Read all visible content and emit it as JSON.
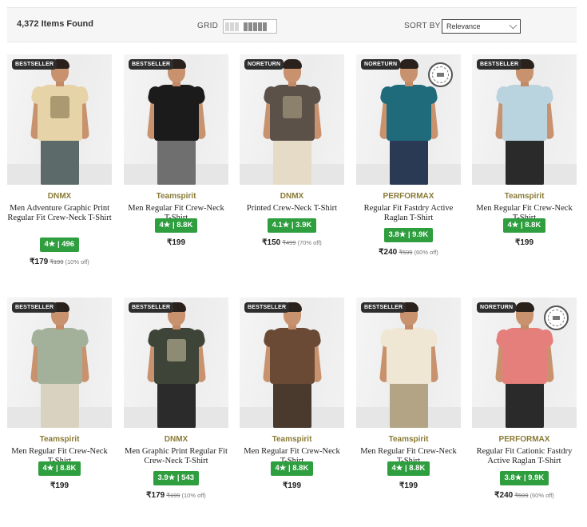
{
  "toolbar": {
    "items_found": "4,372 Items Found",
    "grid_label": "GRID",
    "sort_label": "SORT BY",
    "sort_value": "Relevance"
  },
  "colors": {
    "rating_green": "#2e9e3f",
    "brand_olive": "#8a7a36",
    "tag_dark": "#2e2e2e"
  },
  "products": [
    {
      "tag": "BESTSELLER",
      "brand": "DNMX",
      "name": "Men Adventure Graphic Print Regular Fit Crew-Neck T-Shirt",
      "rating": "4★ | 496",
      "price": "₹179",
      "mrp": "₹199",
      "off": "(10% off)",
      "seal": false,
      "shirt": "#e7d3a8",
      "pants": "#5c6b6a",
      "print": "#7a6a44"
    },
    {
      "tag": "BESTSELLER",
      "brand": "Teamspirit",
      "name": "Men Regular Fit Crew-Neck T-Shirt",
      "rating": "4★ | 8.8K",
      "price": "₹199",
      "mrp": "",
      "off": "",
      "seal": false,
      "shirt": "#1b1b1b",
      "pants": "#6f6f6f",
      "print": ""
    },
    {
      "tag": "NORETURN",
      "brand": "DNMX",
      "name": "Printed Crew-Neck T-Shirt",
      "rating": "4.1★ | 3.9K",
      "price": "₹150",
      "mrp": "₹499",
      "off": "(70% off)",
      "seal": false,
      "shirt": "#5b5148",
      "pants": "#e6dbc6",
      "print": "#b5a98c"
    },
    {
      "tag": "NORETURN",
      "brand": "PERFORMAX",
      "name": "Regular Fit Fastdry Active Raglan T-Shirt",
      "rating": "3.8★ | 9.9K",
      "price": "₹240",
      "mrp": "₹599",
      "off": "(60% off)",
      "seal": true,
      "shirt": "#1f6a7b",
      "pants": "#2a3a55",
      "print": ""
    },
    {
      "tag": "BESTSELLER",
      "brand": "Teamspirit",
      "name": "Men Regular Fit Crew-Neck T-Shirt",
      "rating": "4★ | 8.8K",
      "price": "₹199",
      "mrp": "",
      "off": "",
      "seal": false,
      "shirt": "#b9d3df",
      "pants": "#2a2a2a",
      "print": ""
    },
    {
      "tag": "BESTSELLER",
      "brand": "Teamspirit",
      "name": "Men Regular Fit Crew-Neck T-Shirt",
      "rating": "4★ | 8.8K",
      "price": "₹199",
      "mrp": "",
      "off": "",
      "seal": false,
      "shirt": "#a3b19a",
      "pants": "#d9d2c0",
      "print": ""
    },
    {
      "tag": "BESTSELLER",
      "brand": "DNMX",
      "name": "Men Graphic Print Regular Fit Crew-Neck T-Shirt",
      "rating": "3.9★ | 543",
      "price": "₹179",
      "mrp": "₹199",
      "off": "(10% off)",
      "seal": false,
      "shirt": "#3e4438",
      "pants": "#2b2b2b",
      "print": "#cfc6a8"
    },
    {
      "tag": "BESTSELLER",
      "brand": "Teamspirit",
      "name": "Men Regular Fit Crew-Neck T-Shirt",
      "rating": "4★ | 8.8K",
      "price": "₹199",
      "mrp": "",
      "off": "",
      "seal": false,
      "shirt": "#6a4a35",
      "pants": "#4a3a2e",
      "print": ""
    },
    {
      "tag": "BESTSELLER",
      "brand": "Teamspirit",
      "name": "Men Regular Fit Crew-Neck T-Shirt",
      "rating": "4★ | 8.8K",
      "price": "₹199",
      "mrp": "",
      "off": "",
      "seal": false,
      "shirt": "#efe6d3",
      "pants": "#b3a486",
      "print": ""
    },
    {
      "tag": "NORETURN",
      "brand": "PERFORMAX",
      "name": "Regular Fit Cationic Fastdry Active Raglan T-Shirt",
      "rating": "3.8★ | 9.9K",
      "price": "₹240",
      "mrp": "₹599",
      "off": "(60% off)",
      "seal": true,
      "shirt": "#e57f7c",
      "pants": "#2a2a2a",
      "print": ""
    }
  ]
}
